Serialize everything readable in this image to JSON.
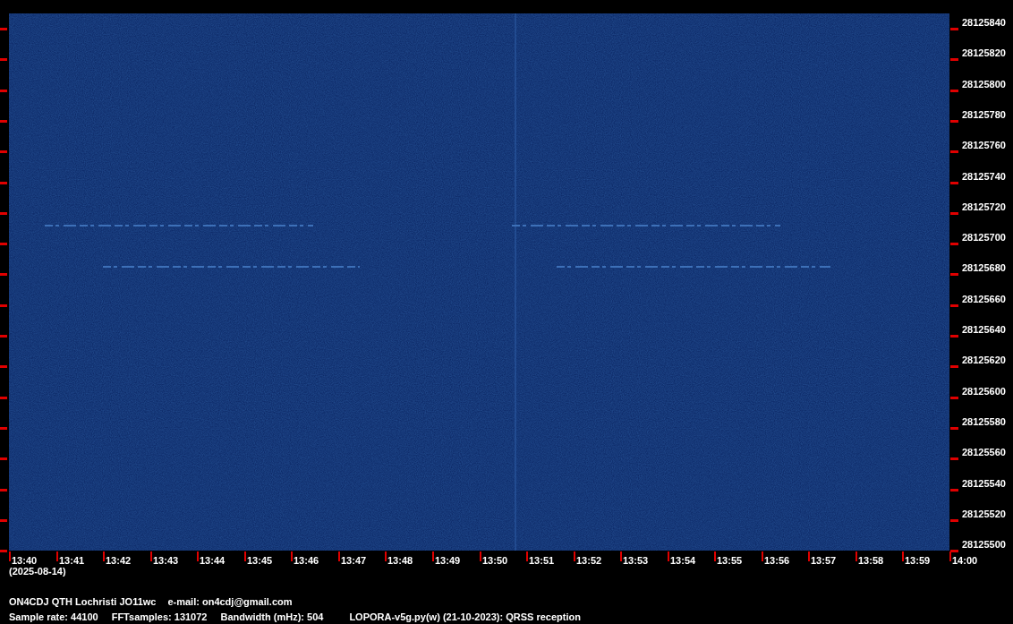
{
  "plot": {
    "time_labels": [
      "13:40",
      "13:41",
      "13:42",
      "13:43",
      "13:44",
      "13:45",
      "13:46",
      "13:47",
      "13:48",
      "13:49",
      "13:50",
      "13:51",
      "13:52",
      "13:53",
      "13:54",
      "13:55",
      "13:56",
      "13:57",
      "13:58",
      "13:59",
      "14:00"
    ],
    "date": "(2025-08-14)",
    "frequency_labels": [
      "28125840",
      "28125820",
      "28125800",
      "28125780",
      "28125760",
      "28125740",
      "28125720",
      "28125700",
      "28125680",
      "28125660",
      "28125640",
      "28125620",
      "28125600",
      "28125580",
      "28125560",
      "28125540",
      "28125520",
      "28125500"
    ]
  },
  "footer": {
    "station": "ON4CDJ QTH Lochristi JO11wc",
    "email": "e-mail: on4cdj@gmail.com",
    "params": [
      "Sample rate: 44100",
      "FFTsamples: 131072",
      "Bandwidth (mHz): 504"
    ],
    "program": "LOPORA-v5g.py(w) (21-10-2023): QRSS reception"
  }
}
